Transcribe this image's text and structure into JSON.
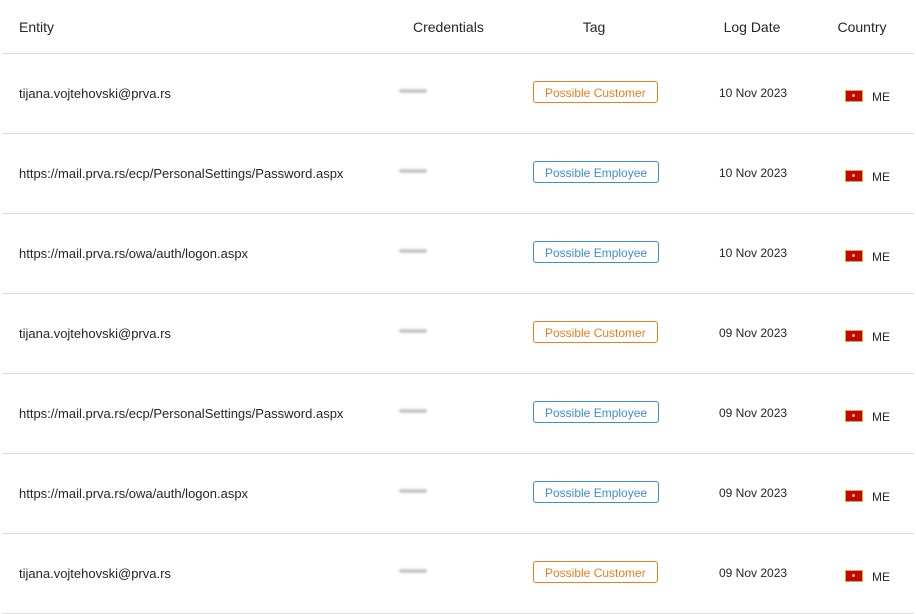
{
  "header": {
    "entity": "Entity",
    "credentials": "Credentials",
    "tag": "Tag",
    "log_date": "Log Date",
    "country": "Country"
  },
  "rows": [
    {
      "entity": "tijana.vojtehovski@prva.rs",
      "tag": "Possible Customer",
      "tag_type": "customer",
      "date": "10 Nov 2023",
      "country": "ME"
    },
    {
      "entity": "https://mail.prva.rs/ecp/PersonalSettings/Password.aspx",
      "tag": "Possible Employee",
      "tag_type": "employee",
      "date": "10 Nov 2023",
      "country": "ME"
    },
    {
      "entity": "https://mail.prva.rs/owa/auth/logon.aspx",
      "tag": "Possible Employee",
      "tag_type": "employee",
      "date": "10 Nov 2023",
      "country": "ME"
    },
    {
      "entity": "tijana.vojtehovski@prva.rs",
      "tag": "Possible Customer",
      "tag_type": "customer",
      "date": "09 Nov 2023",
      "country": "ME"
    },
    {
      "entity": "https://mail.prva.rs/ecp/PersonalSettings/Password.aspx",
      "tag": "Possible Employee",
      "tag_type": "employee",
      "date": "09 Nov 2023",
      "country": "ME"
    },
    {
      "entity": "https://mail.prva.rs/owa/auth/logon.aspx",
      "tag": "Possible Employee",
      "tag_type": "employee",
      "date": "09 Nov 2023",
      "country": "ME"
    },
    {
      "entity": "tijana.vojtehovski@prva.rs",
      "tag": "Possible Customer",
      "tag_type": "customer",
      "date": "09 Nov 2023",
      "country": "ME"
    }
  ],
  "colors": {
    "customer_tag": "#e67e22",
    "employee_tag": "#3b8fd6",
    "flag_red": "#c40308",
    "flag_gold": "#d3ae3b"
  },
  "icons": {
    "country_flag": "montenegro-flag-icon"
  }
}
